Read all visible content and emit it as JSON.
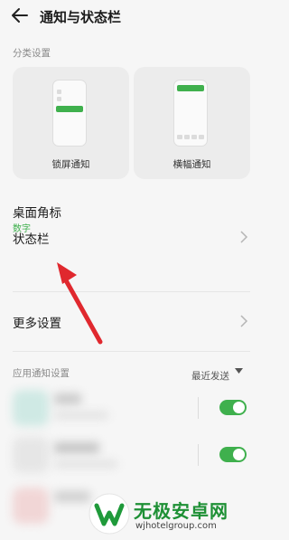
{
  "header": {
    "title": "通知与状态栏"
  },
  "category_settings": {
    "label": "分类设置",
    "cards": [
      {
        "label": "锁屏通知"
      },
      {
        "label": "横幅通知"
      }
    ]
  },
  "rows": {
    "desktop_badge": {
      "title": "桌面角标",
      "subtitle": "数字"
    },
    "status_bar": {
      "title": "状态栏"
    },
    "more_settings": {
      "title": "更多设置"
    }
  },
  "app_notifications": {
    "label": "应用通知设置",
    "sort_label": "最近发送",
    "apps": [
      {
        "enabled": true
      },
      {
        "enabled": true
      },
      {
        "enabled": true
      }
    ]
  },
  "watermark": {
    "brand_text": "无极安卓网",
    "url": "wjhotelgroup.com"
  },
  "colors": {
    "accent_green": "#3fb04d",
    "annotation_arrow": "#e0282e"
  }
}
